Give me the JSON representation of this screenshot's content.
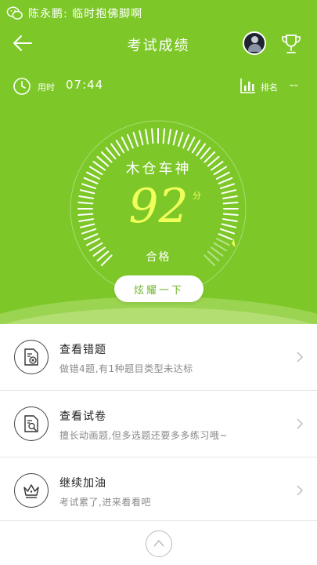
{
  "notification": {
    "sender": "陈永鹏",
    "separator": ":",
    "message": "临时抱佛脚啊"
  },
  "header": {
    "title": "考试成绩"
  },
  "stats": {
    "time_label": "用时",
    "time_value": "07:44",
    "rank_label": "排名",
    "rank_value": "--"
  },
  "result": {
    "rank_name": "木仓车神",
    "score": "92",
    "score_unit": "分",
    "status": "合格",
    "gauge_fraction": 0.92
  },
  "show_button": {
    "label": "炫耀一下"
  },
  "actions": [
    {
      "title": "查看错题",
      "subtitle": "做错4题,有1种题目类型未达标",
      "icon": "wrong-question-icon"
    },
    {
      "title": "查看试卷",
      "subtitle": "擅长动画题,但多选题还要多多练习哦~",
      "icon": "paper-search-icon"
    },
    {
      "title": "继续加油",
      "subtitle": "考试累了,进来看看吧",
      "icon": "crown-icon"
    }
  ],
  "colors": {
    "accent": "#7dc828",
    "score": "#f0ff5a",
    "text_primary": "#222222",
    "text_secondary": "#8a8a8a"
  }
}
